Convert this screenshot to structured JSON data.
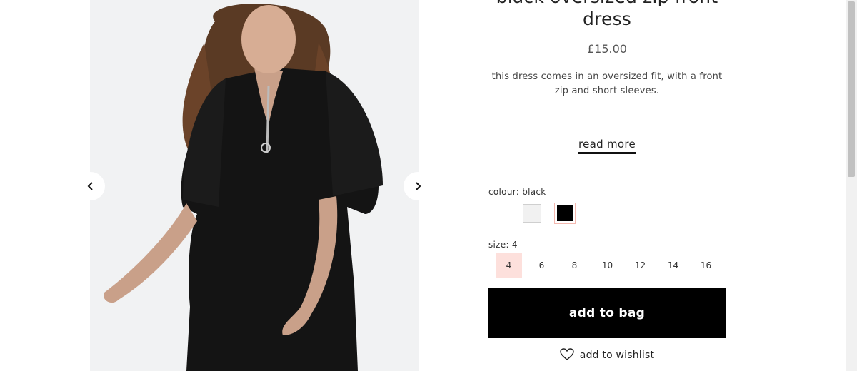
{
  "product": {
    "title_line1": "black oversized zip front",
    "title_line2": "dress",
    "price": "£15.00",
    "description_line1": "this dress comes in an oversized fit, with a front",
    "description_line2": "zip and short sleeves.",
    "read_more": "read more"
  },
  "colour": {
    "label": "colour: black",
    "options": [
      "white",
      "black"
    ],
    "selected": "black"
  },
  "size": {
    "label": "size: 4",
    "options": [
      "4",
      "6",
      "8",
      "10",
      "12",
      "14",
      "16"
    ],
    "selected": "4"
  },
  "actions": {
    "add_to_bag": "add to bag",
    "add_to_wishlist": "add to wishlist"
  },
  "icons": {
    "prev": "chevron-left-icon",
    "next": "chevron-right-icon",
    "wishlist": "heart-icon"
  },
  "colors": {
    "accent_pink": "#fde0dc",
    "button_bg": "#000000",
    "gallery_bg": "#f1f2f3"
  }
}
